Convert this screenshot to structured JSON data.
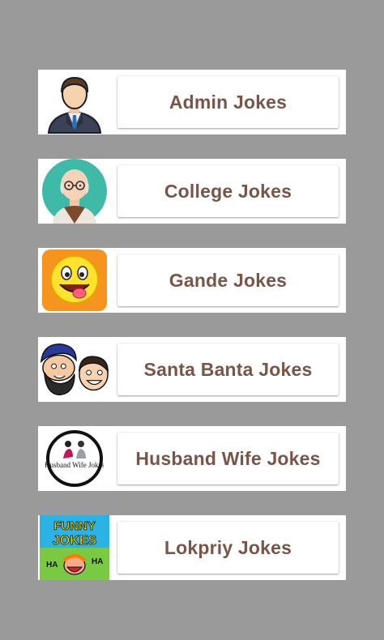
{
  "theme": {
    "background": "#9a9a9a",
    "card": "#ffffff",
    "label_color": "#795548"
  },
  "categories": [
    {
      "label": "Admin Jokes",
      "icon": "businessman-avatar-icon"
    },
    {
      "label": "College Jokes",
      "icon": "professor-avatar-icon"
    },
    {
      "label": "Gande Jokes",
      "icon": "winking-smiley-icon"
    },
    {
      "label": "Santa Banta Jokes",
      "icon": "cartoon-duo-icon"
    },
    {
      "label": "Husband Wife Jokes",
      "icon": "husband-wife-logo-icon",
      "icon_text": "Husband Wife Jokes"
    },
    {
      "label": "Lokpriy Jokes",
      "icon": "funny-jokes-logo-icon",
      "icon_text": [
        "FUNNY",
        "JOKES",
        "HA",
        "HA"
      ]
    }
  ]
}
